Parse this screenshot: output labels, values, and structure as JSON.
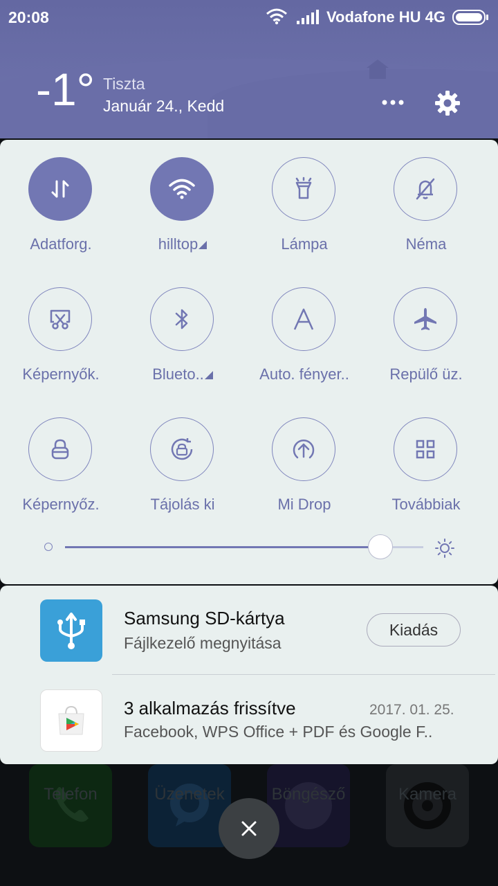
{
  "status_bar": {
    "time": "20:08",
    "carrier": "Vodafone HU 4G"
  },
  "weather": {
    "temperature": "-1°",
    "condition": "Tiszta",
    "date": "Január 24., Kedd"
  },
  "quick_settings": {
    "tiles": [
      {
        "label": "Adatforg.",
        "icon": "data-transfer-icon",
        "active": true
      },
      {
        "label": "hilltop",
        "icon": "wifi-icon",
        "active": true
      },
      {
        "label": "Lámpa",
        "icon": "flashlight-icon",
        "active": false
      },
      {
        "label": "Néma",
        "icon": "bell-off-icon",
        "active": false
      },
      {
        "label": "Képernyők.",
        "icon": "screenshot-icon",
        "active": false
      },
      {
        "label": "Blueto..",
        "icon": "bluetooth-icon",
        "active": false
      },
      {
        "label": "Auto. fényer..",
        "icon": "auto-brightness-icon",
        "active": false
      },
      {
        "label": "Repülő üz.",
        "icon": "airplane-icon",
        "active": false
      },
      {
        "label": "Képernyőz.",
        "icon": "lock-icon",
        "active": false
      },
      {
        "label": "Tájolás ki",
        "icon": "rotation-lock-icon",
        "active": false
      },
      {
        "label": "Mi Drop",
        "icon": "mi-drop-icon",
        "active": false
      },
      {
        "label": "Továbbiak",
        "icon": "grid-icon",
        "active": false
      }
    ],
    "brightness": 0.88
  },
  "notifications": [
    {
      "title": "Samsung SD-kártya",
      "subtitle": "Fájlkezelő megnyitása",
      "action": "Kiadás",
      "icon": "usb-icon"
    },
    {
      "title": "3 alkalmazás frissítve",
      "subtitle": "Facebook, WPS Office + PDF és Google F..",
      "date": "2017. 01. 25.",
      "icon": "play-store-icon"
    }
  ],
  "dock": {
    "apps": [
      "Telefon",
      "Üzenetek",
      "Böngésző",
      "Kamera"
    ]
  },
  "colors": {
    "accent": "#7277b3",
    "header": "#6a6ea8",
    "panel": "#e9f0ef"
  }
}
